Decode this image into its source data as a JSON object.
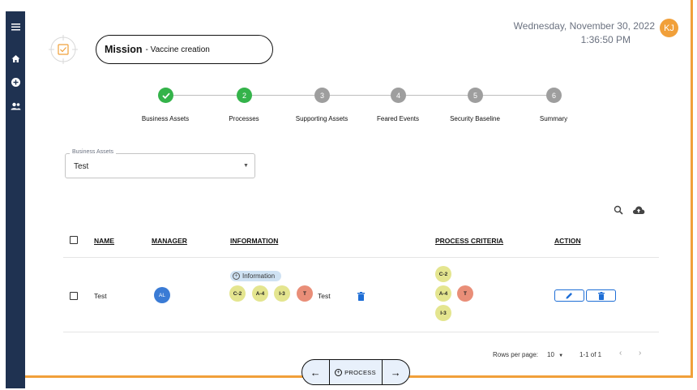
{
  "sidebar": {
    "icons": [
      "menu-icon",
      "home-icon",
      "add-circle-icon",
      "group-icon"
    ]
  },
  "header": {
    "mission_label": "Mission",
    "mission_value": "- Vaccine creation",
    "date": "Wednesday, November 30, 2022",
    "time": "1:36:50 PM",
    "user_initials": "KJ"
  },
  "stepper": {
    "steps": [
      {
        "number": "✓",
        "label": "Business Assets",
        "state": "done"
      },
      {
        "number": "2",
        "label": "Processes",
        "state": "active"
      },
      {
        "number": "3",
        "label": "Supporting Assets",
        "state": "pending"
      },
      {
        "number": "4",
        "label": "Feared Events",
        "state": "pending"
      },
      {
        "number": "5",
        "label": "Security Baseline",
        "state": "pending"
      },
      {
        "number": "6",
        "label": "Summary",
        "state": "pending"
      }
    ]
  },
  "business_assets": {
    "label": "Business Assets",
    "value": "Test"
  },
  "table": {
    "headers": {
      "name": "NAME",
      "manager": "MANAGER",
      "information": "INFORMATION",
      "process_criteria": "PROCESS CRITERIA",
      "action": "ACTION"
    },
    "rows": [
      {
        "name": "Test",
        "manager_initials": "AL",
        "information_tag": "Information",
        "information_chips": [
          "C-2",
          "A-4",
          "I-3",
          "T"
        ],
        "information_text": "Test",
        "criteria_chips": [
          "C-2",
          "A-4",
          "T",
          "I-3"
        ]
      }
    ]
  },
  "pagination": {
    "rows_per_page_label": "Rows per page:",
    "rows_per_page_value": "10",
    "range": "1-1 of 1"
  },
  "nav": {
    "process_label": "PROCESS"
  },
  "colors": {
    "sidebar": "#1f3251",
    "accent_orange": "#f1a03a",
    "step_done": "#34b34a",
    "step_pending": "#9e9e9e",
    "chip_yellow": "#e4e58f",
    "chip_orange": "#e98e78",
    "primary_blue": "#1e6ed6"
  }
}
